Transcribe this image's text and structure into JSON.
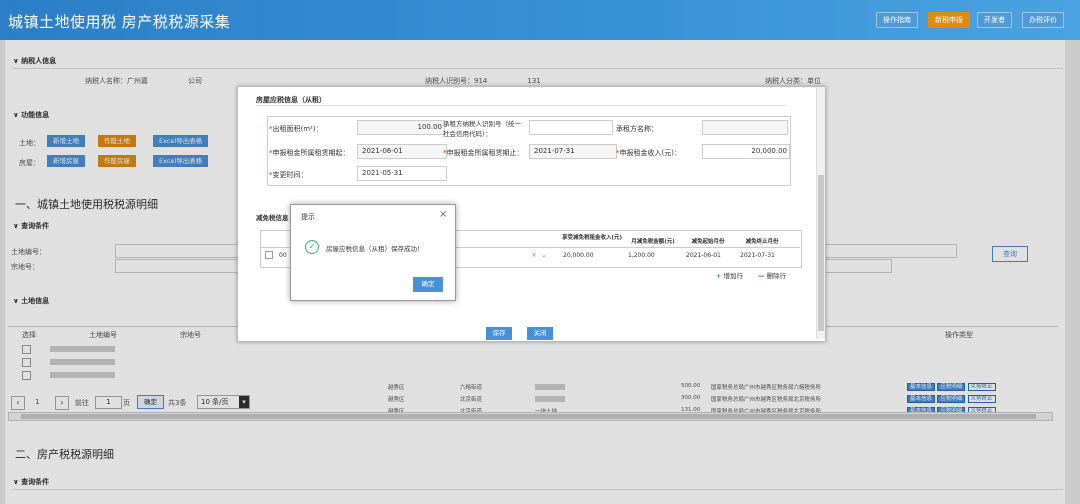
{
  "header": {
    "title": "城镇土地使用税 房产税税源采集",
    "buttons": [
      "操作指南",
      "新税申报",
      "开发者",
      "办税评价"
    ]
  },
  "taxpayer": {
    "section": "纳税人信息",
    "name_label": "纳税人名称：广州嘉",
    "name_suffix": "公司",
    "id_label": "纳税人识别号：914",
    "id_suffix": "131",
    "type_label": "纳税人分类：单位"
  },
  "functions": {
    "section": "功能信息",
    "land_label": "土地：",
    "land_buttons": [
      "新增土地",
      "作废土地",
      "Excel导出表格"
    ],
    "house_label": "房屋：",
    "house_buttons": [
      "新增房屋",
      "作废房屋",
      "Excel导出表格"
    ]
  },
  "part1": {
    "title": "一、城镇土地使用税税源明细",
    "query_section": "查询条件",
    "land_no_label": "土地编号：",
    "zone_label": "宗地号：",
    "query_button": "查询",
    "land_info_section": "土地信息",
    "col_select": "选择",
    "col_land_no": "土地编号",
    "col_no": "宗地号",
    "col_ops": "操作类型",
    "rows": [
      {
        "district": "越秀区",
        "street": "六榕街道",
        "name": "",
        "amount": "500.00",
        "org": "国家税务总局广州市越秀区税务局六榕税务所"
      },
      {
        "district": "越秀区",
        "street": "北京街道",
        "name": "",
        "amount": "300.00",
        "org": "国家税务总局广州市越秀区税务局北京税务所"
      },
      {
        "district": "越秀区",
        "street": "北京街道",
        "name": "一块土地",
        "amount": "131.00",
        "org": "国家税务总局广州市越秀区税务局北京税务所"
      }
    ],
    "row_ops": [
      "基本信息",
      "应税明细",
      "义务终止"
    ],
    "pager": {
      "page": "1",
      "goto_label": "前往",
      "page_unit": "页",
      "confirm": "确定",
      "total": "共3条",
      "per_page": "10 条/页"
    }
  },
  "part2": {
    "title": "二、房产税税源明细",
    "query_section": "查询条件"
  },
  "modal": {
    "section_title": "房屋应税信息（从租）",
    "rent_area_label": "出租面积(m²)：",
    "rent_area_value": "100.00",
    "lessee_id_label": "承租方纳税人识别号（统一社会信用代码）：",
    "lessee_id_value": "",
    "lessee_name_label": "承租方名称：",
    "lessee_name_value": "",
    "period_start_label": "申报租金所属租赁期起：",
    "period_start_value": "2021-06-01",
    "period_end_label": "申报租金所属租赁期止：",
    "period_end_value": "2021-07-31",
    "income_label": "申报租金收入(元)：",
    "income_value": "20,000.00",
    "change_time_label": "变更时间：",
    "change_time_value": "2021-05-31",
    "relief_section": "减免税信息",
    "relief_cols": [
      "享受减免税租金收入(元)",
      "月减免税金额(元)",
      "减免起始月份",
      "减免终止月份"
    ],
    "relief_row": {
      "code": "00",
      "income": "20,000.00",
      "monthly": "1,200.00",
      "start": "2021-06-01",
      "end": "2021-07-31"
    },
    "add_row": "增加行",
    "del_row": "删除行",
    "save": "保存",
    "close": "关闭"
  },
  "alert": {
    "title": "提示",
    "message": "房屋应税信息（从租）保存成功！",
    "ok": "确定"
  },
  "colors": {
    "primary": "#4a90d9",
    "orange": "#e08a10",
    "success": "#3cb371"
  }
}
